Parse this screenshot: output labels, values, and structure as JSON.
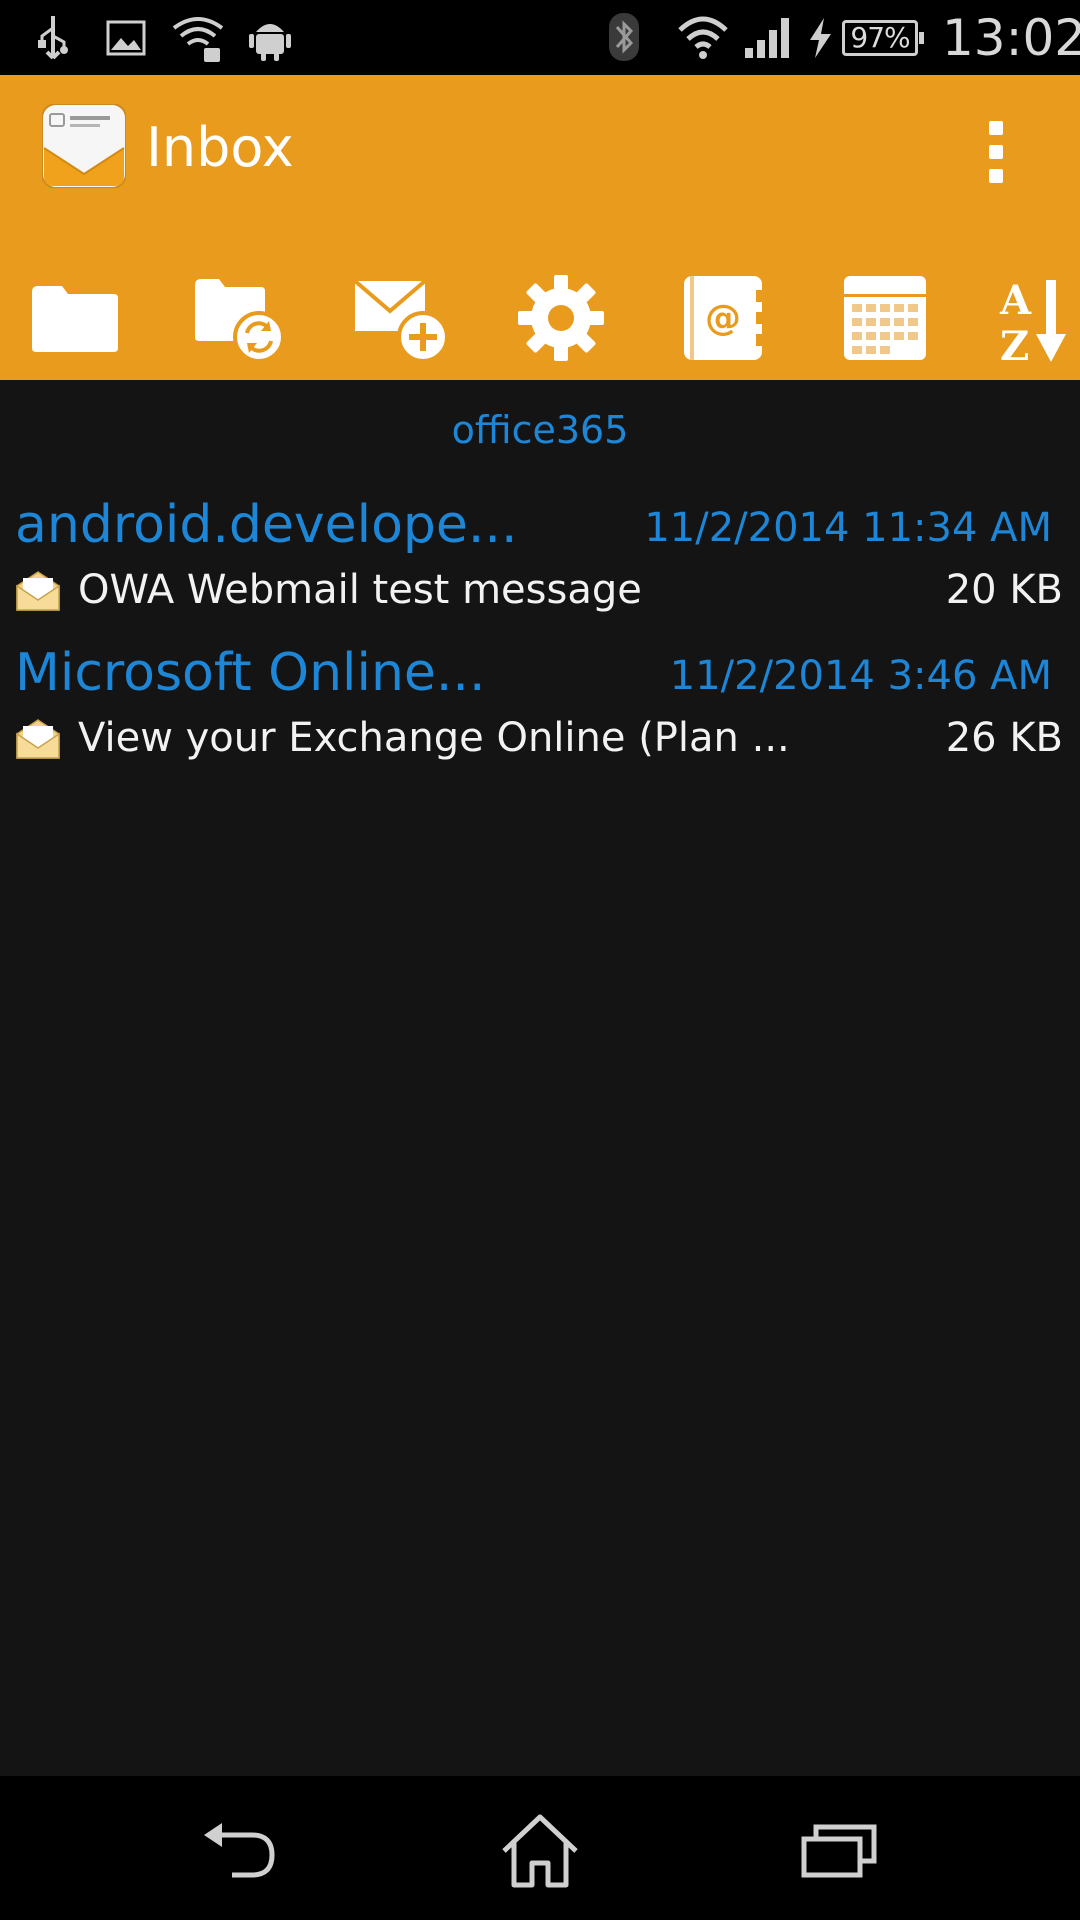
{
  "status_bar": {
    "time": "13:02",
    "battery": "97%",
    "icons": [
      "usb-icon",
      "image-icon",
      "wifi-data-icon",
      "android-icon",
      "bluetooth-icon",
      "wifi-icon",
      "signal-icon",
      "charging-icon"
    ]
  },
  "app_bar": {
    "title": "Inbox",
    "logo": "mail-app-logo",
    "overflow": "overflow-menu-icon",
    "accent_color": "#e89b1c"
  },
  "toolbar": {
    "items": [
      {
        "icon": "folder-icon"
      },
      {
        "icon": "sync-folder-icon"
      },
      {
        "icon": "compose-mail-icon"
      },
      {
        "icon": "settings-gear-icon"
      },
      {
        "icon": "contacts-icon"
      },
      {
        "icon": "calendar-icon"
      },
      {
        "icon": "sort-az-icon"
      }
    ]
  },
  "account": {
    "label": "office365"
  },
  "messages": [
    {
      "sender": "android.develope...",
      "date": "11/2/2014 11:34 AM",
      "subject": "OWA Webmail test message",
      "size": "20 KB",
      "icon": "open-envelope-icon"
    },
    {
      "sender": "Microsoft Online...",
      "date": "11/2/2014 3:46 AM",
      "subject": "View your Exchange Online (Plan ...",
      "size": "26 KB",
      "icon": "open-envelope-icon"
    }
  ],
  "nav_bar": {
    "items": [
      "back-icon",
      "home-icon",
      "recent-apps-icon"
    ]
  },
  "colors": {
    "link_blue": "#1d86d6",
    "background": "#141414"
  }
}
